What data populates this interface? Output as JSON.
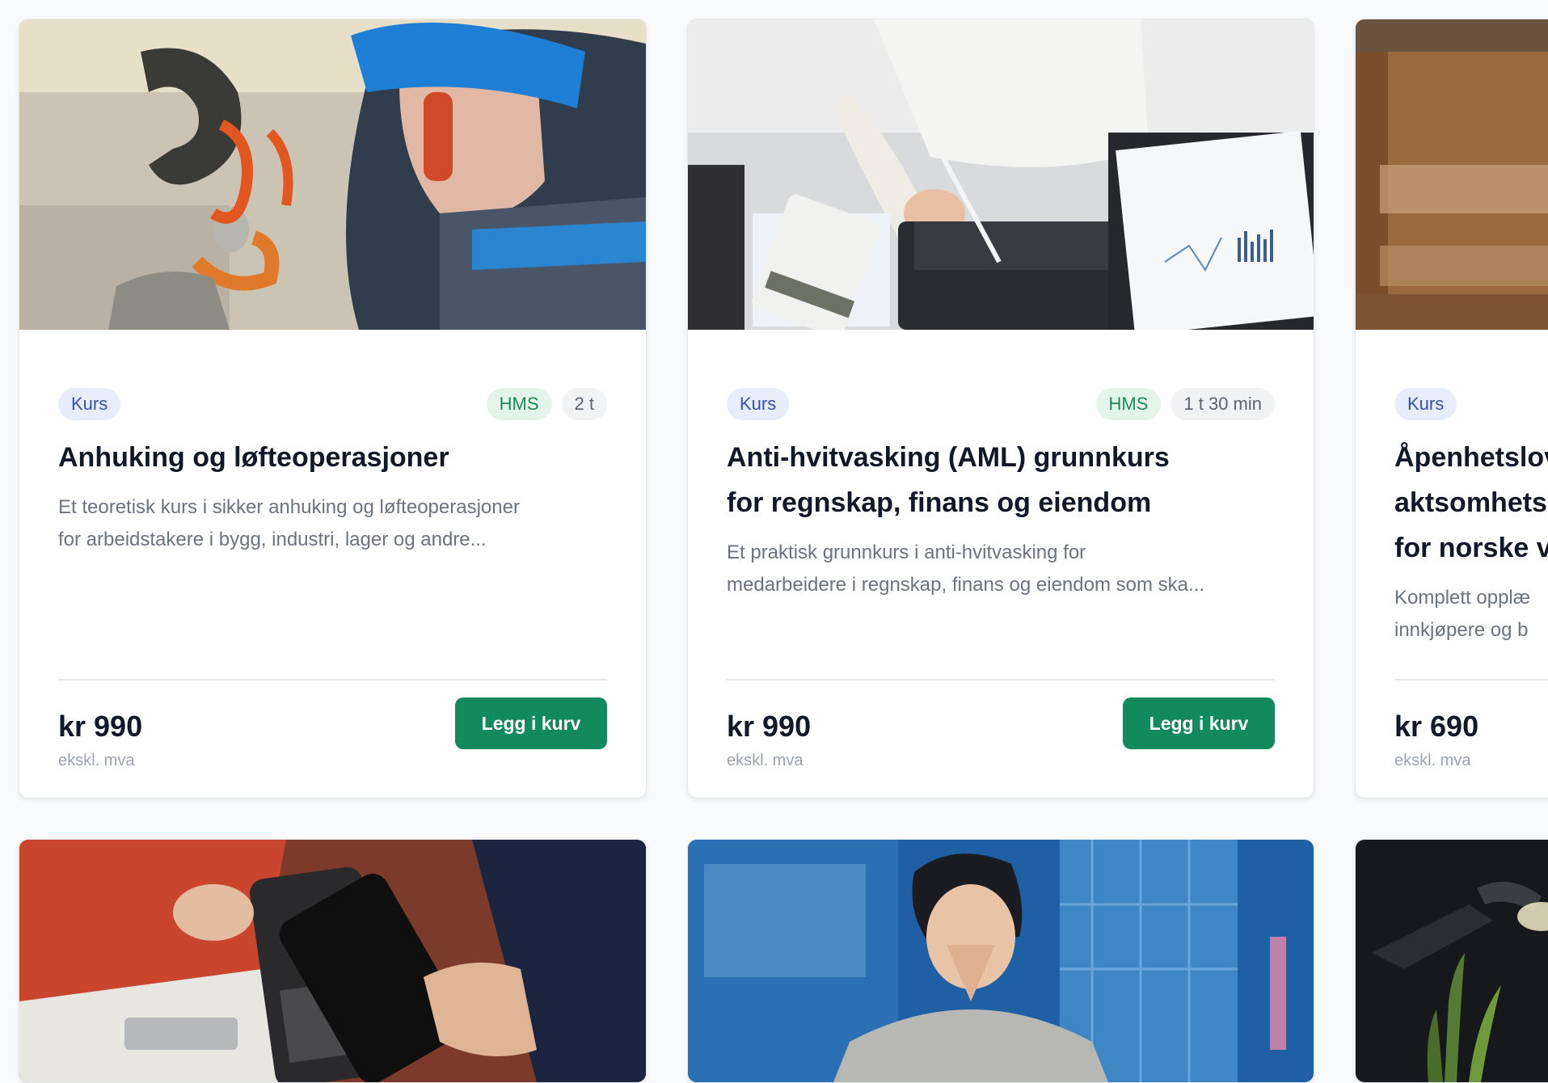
{
  "cards": [
    {
      "type_badge": "Kurs",
      "category_badge": "HMS",
      "duration_badge": "2 t",
      "title_lines": [
        "Anhuking og løfteoperasjoner"
      ],
      "description_lines": [
        "Et teoretisk kurs i sikker anhuking og løfteoperasjoner",
        "for arbeidstakere i bygg, industri, lager og andre..."
      ],
      "price": "kr 990",
      "vat_note": "ekskl. mva",
      "button_label": "Legg i kurv",
      "image_icon": "crane-hook-worker-image"
    },
    {
      "type_badge": "Kurs",
      "category_badge": "HMS",
      "duration_badge": "1 t 30 min",
      "title_lines": [
        "Anti-hvitvasking (AML) grunnkurs",
        "for regnskap, finans og eiendom"
      ],
      "description_lines": [
        "Et praktisk grunnkurs i anti-hvitvasking for",
        "medarbeidere i regnskap, finans og eiendom som ska..."
      ],
      "price": "kr 990",
      "vat_note": "ekskl. mva",
      "button_label": "Legg i kurv",
      "image_icon": "desk-calculator-tablet-image"
    },
    {
      "type_badge": "Kurs",
      "title_lines": [
        "Åpenhetslov",
        "aktsomhets",
        "for norske v"
      ],
      "description_lines": [
        "Komplett opplæ",
        "innkjøpere og b"
      ],
      "price": "kr 690",
      "vat_note": "ekskl. mva",
      "image_icon": "blurred-wood-image"
    }
  ],
  "colors": {
    "primary_button": "#138a5e",
    "kurs_badge_bg": "#e8edfb",
    "kurs_badge_text": "#3451b2",
    "hms_badge_bg": "#e3f4ea",
    "hms_badge_text": "#1f8a55",
    "duration_badge_bg": "#f1f2f4"
  }
}
